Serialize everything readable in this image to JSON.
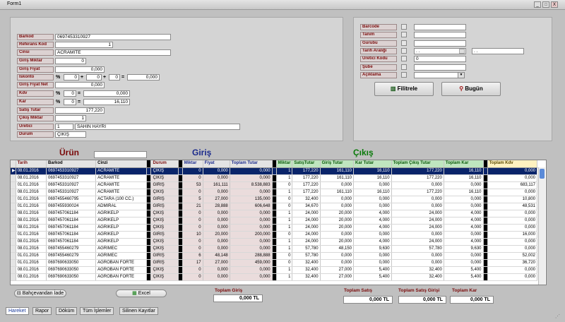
{
  "window": {
    "title": "Form1",
    "min": "_",
    "max": "□",
    "close": "X"
  },
  "form": {
    "barkod_label": "Barkod",
    "barkod": "0697453310927",
    "referans_label": "Referans Kod",
    "referans": "1",
    "cinsi_label": "Cinsi",
    "cinsi": "ACRAMITE",
    "giris_miktar_label": "Giriş Miktar",
    "giris_miktar": "0",
    "giris_fiyat_label": "Giriş Fiyat",
    "giris_fiyat": "0,000",
    "iskonto_label": "İskonto",
    "iskonto_1": "0",
    "iskonto_2": "0",
    "iskonto_3": "0",
    "iskonto_result": "0,000",
    "giris_fiyat_net_label": "Giriş Fiyat Net",
    "giris_fiyat_net": "0,000",
    "kdv_label": "Kdv",
    "kdv_pct": "0",
    "kdv_result": "0,000",
    "kar_label": "Kar",
    "kar_pct": "0",
    "kar_result": "16,110",
    "satis_tutar_label": "Satış Tutar",
    "satis_tutar": "177,220",
    "cikis_miktar_label": "Çıkış Miktar",
    "cikis_miktar": "1",
    "uretici_label": "Üretici",
    "uretici_code": "1",
    "uretici_name": "SAHIN HAYRI",
    "durum_label": "Durum",
    "durum": "ÇIKIŞ",
    "pct": "%",
    "plus": "+",
    "eq": "="
  },
  "filter": {
    "barcode_label": "Barcode",
    "tanim_label": "Tanım",
    "gurubu_label": "Gurubu",
    "tarih_label": "Tarih Aralığı",
    "tarih_from": ". .",
    "tarih_to": ". .",
    "uretici_kodu_label": "Üretici Kodu",
    "uretici_kodu": "0",
    "sube_label": "Şube",
    "aciklama_label": "Açıklama",
    "filtrele_label": "Filitrele",
    "bugun_label": "Bugün"
  },
  "sections": {
    "urun": "Ürün",
    "giris": "Giriş",
    "cikis": "Çıkış"
  },
  "grid": {
    "headers": [
      "Tarih",
      "Barkod",
      "Cinzi",
      "Durum",
      "Miktar",
      "Fiyat",
      "Toplam Tutar",
      "Miktar",
      "SatışTutar",
      "Giriş Tutar",
      "Kar Tutar",
      "Toplam Çıkış Tutar",
      "Toplam Kar",
      "Toplam Kdv"
    ],
    "rows": [
      [
        "08.01.2016",
        "0697453310927",
        "ACRAMITE",
        "ÇIKIŞ",
        "0",
        "0,000",
        "0,000",
        "1",
        "177,220",
        "161,110",
        "16,110",
        "177,220",
        "16,110",
        "0,000"
      ],
      [
        "08.01.2016",
        "0697453310927",
        "ACRAMITE",
        "ÇIKIŞ",
        "0",
        "0,000",
        "0,000",
        "1",
        "177,220",
        "161,110",
        "16,110",
        "177,220",
        "16,110",
        "0,000"
      ],
      [
        "01.01.2016",
        "0697453310927",
        "ACRAMITE",
        "GİRİŞ",
        "53",
        "161,111",
        "8.538,883",
        "0",
        "177,220",
        "0,000",
        "0,000",
        "0,000",
        "0,000",
        "683,117"
      ],
      [
        "08.01.2016",
        "0697453310927",
        "ACRAMITE",
        "ÇIKIŞ",
        "0",
        "0,000",
        "0,000",
        "1",
        "177,220",
        "161,110",
        "16,110",
        "177,220",
        "16,110",
        "0,000"
      ],
      [
        "01.01.2016",
        "0697455460795",
        "ACTARA (100 CC.)",
        "GİRİŞ",
        "5",
        "27,000",
        "135,000",
        "0",
        "32,400",
        "0,000",
        "0,000",
        "0,000",
        "0,000",
        "10,800"
      ],
      [
        "01.01.2016",
        "0697455930024",
        "ADMIRAL",
        "GİRİŞ",
        "21",
        "28,888",
        "606,648",
        "0",
        "34,670",
        "0,000",
        "0,000",
        "0,000",
        "0,000",
        "48,531"
      ],
      [
        "08.01.2016",
        "0697457061184",
        "AGRIKELP",
        "ÇIKIŞ",
        "0",
        "0,000",
        "0,000",
        "1",
        "24,000",
        "20,000",
        "4,000",
        "24,000",
        "4,000",
        "0,000"
      ],
      [
        "08.01.2016",
        "0697457061184",
        "AGRIKELP",
        "ÇIKIŞ",
        "0",
        "0,000",
        "0,000",
        "1",
        "24,000",
        "20,000",
        "4,000",
        "24,000",
        "4,000",
        "0,000"
      ],
      [
        "08.01.2016",
        "0697457061184",
        "AGRIKELP",
        "ÇIKIŞ",
        "0",
        "0,000",
        "0,000",
        "1",
        "24,000",
        "20,000",
        "4,000",
        "24,000",
        "4,000",
        "0,000"
      ],
      [
        "01.01.2016",
        "0697457061184",
        "AGRIKELP",
        "GİRİŞ",
        "10",
        "20,000",
        "200,000",
        "0",
        "24,000",
        "0,000",
        "0,000",
        "0,000",
        "0,000",
        "16,000"
      ],
      [
        "08.01.2016",
        "0697457061184",
        "AGRIKELP",
        "ÇIKIŞ",
        "0",
        "0,000",
        "0,000",
        "1",
        "24,000",
        "20,000",
        "4,000",
        "24,000",
        "4,000",
        "0,000"
      ],
      [
        "08.01.2016",
        "0697455460279",
        "AGRIMEC",
        "ÇIKIŞ",
        "0",
        "0,000",
        "0,000",
        "1",
        "57,780",
        "48,150",
        "9,630",
        "57,780",
        "9,630",
        "0,000"
      ],
      [
        "01.01.2016",
        "0697455460279",
        "AGRIMEC",
        "GİRİŞ",
        "6",
        "48,148",
        "288,888",
        "0",
        "57,780",
        "0,000",
        "0,000",
        "0,000",
        "0,000",
        "52,002"
      ],
      [
        "01.01.2016",
        "0697690633050",
        "AGROBAN FORTE",
        "GİRİŞ",
        "17",
        "27,000",
        "459,000",
        "0",
        "32,400",
        "0,000",
        "0,000",
        "0,000",
        "0,000",
        "36,720"
      ],
      [
        "08.01.2016",
        "0697690633050",
        "AGROBAN FORTE",
        "ÇIKIŞ",
        "0",
        "0,000",
        "0,000",
        "1",
        "32,400",
        "27,000",
        "5,400",
        "32,400",
        "5,400",
        "0,000"
      ],
      [
        "08.01.2016",
        "0697690633050",
        "AGROBAN FORTE",
        "ÇIKIŞ",
        "0",
        "0,000",
        "0,000",
        "1",
        "32,400",
        "27,000",
        "5,400",
        "32,400",
        "5,400",
        "0,000"
      ]
    ]
  },
  "bottom": {
    "bahce_label": "Bahçevandan İade",
    "excel_label": "Excel",
    "toplam_giris_label": "Toplam Giriş",
    "toplam_giris": "0,000 TL",
    "toplam_satis_label": "Toplam Satış",
    "toplam_satis": "0,000 TL",
    "toplam_satis_girisi_label": "Toplam Satış Girişi",
    "toplam_satis_girisi": "0,000 TL",
    "toplam_kar_label": "Toplam  Kar",
    "toplam_kar": "0,000 TL"
  },
  "tabs": [
    "Hareket",
    "Rapor",
    "Döküm",
    "Tüm İşlemler",
    "Silinen Kayıtlar"
  ]
}
